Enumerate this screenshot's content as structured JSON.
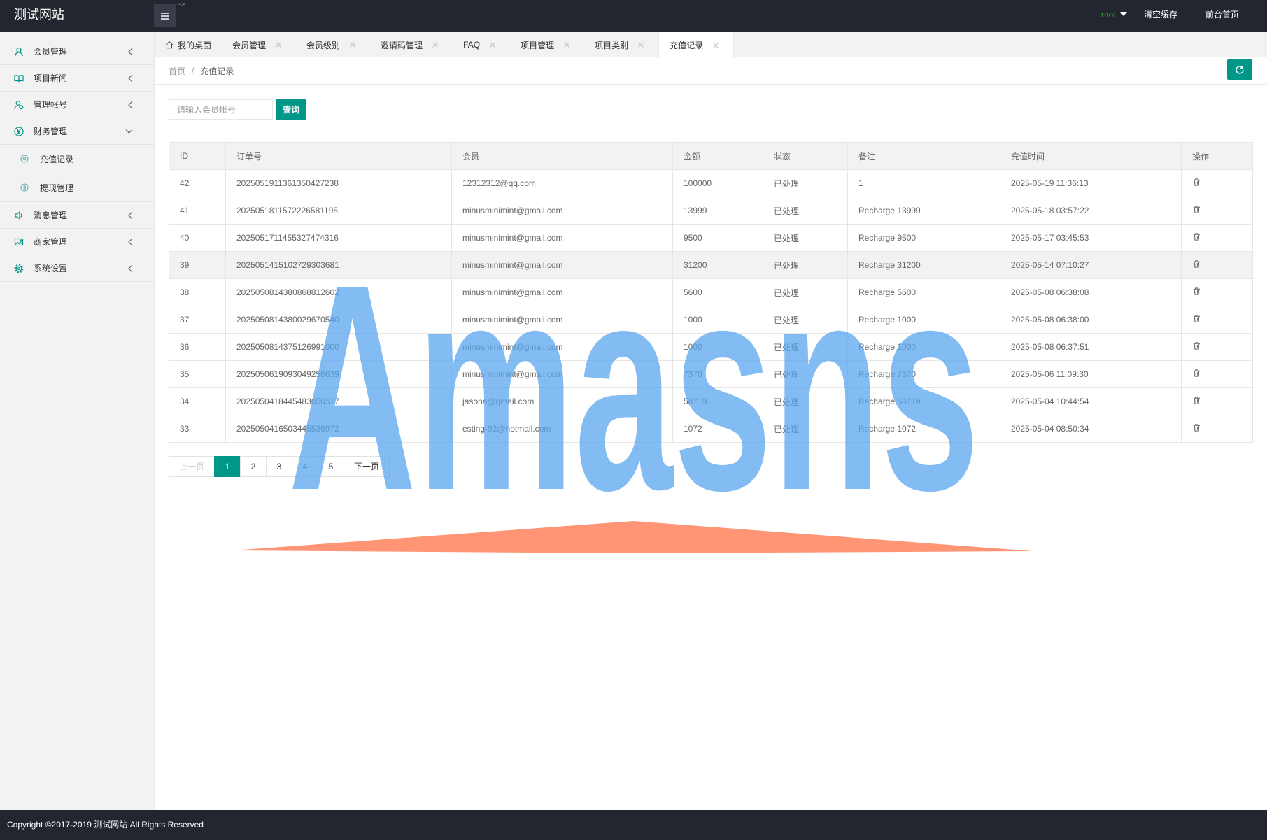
{
  "header": {
    "logo": "测试网站",
    "stray_text": "-->",
    "user": "root",
    "clear_cache": "清空缓存",
    "front_home": "前台首页"
  },
  "sidebar": {
    "items": [
      {
        "label": "会员管理",
        "icon": "user-icon"
      },
      {
        "label": "项目新闻",
        "icon": "book-icon"
      },
      {
        "label": "管理帐号",
        "icon": "users-icon"
      },
      {
        "label": "财务管理",
        "icon": "yen-icon",
        "expanded": true,
        "children": [
          {
            "label": "充值记录",
            "icon": "record-icon"
          },
          {
            "label": "提现管理",
            "icon": "dollar-icon"
          }
        ]
      },
      {
        "label": "消息管理",
        "icon": "speaker-icon"
      },
      {
        "label": "商家管理",
        "icon": "image-icon"
      },
      {
        "label": "系统设置",
        "icon": "gear-icon"
      }
    ]
  },
  "tabs": [
    {
      "label": "我的桌面",
      "icon": "home-icon",
      "closable": false
    },
    {
      "label": "会员管理",
      "closable": true
    },
    {
      "label": "会员级别",
      "closable": true
    },
    {
      "label": "邀请码管理",
      "closable": true
    },
    {
      "label": "FAQ",
      "closable": true
    },
    {
      "label": "项目管理",
      "closable": true
    },
    {
      "label": "项目类别",
      "closable": true
    },
    {
      "label": "充值记录",
      "closable": true,
      "active": true
    }
  ],
  "breadcrumb": {
    "home": "首页",
    "separator": "/",
    "current": "充值记录"
  },
  "search": {
    "placeholder": "请输入会员帐号",
    "value": "",
    "button": "查询"
  },
  "table": {
    "columns": [
      "ID",
      "订单号",
      "会员",
      "金额",
      "状态",
      "备注",
      "充值时间",
      "操作"
    ],
    "rows": [
      {
        "id": "42",
        "order_no": "2025051911361350427238",
        "member": "12312312@qq.com",
        "amount": "100000",
        "status": "已处理",
        "remark": "1",
        "time": "2025-05-19 11:36:13"
      },
      {
        "id": "41",
        "order_no": "2025051811572226581195",
        "member": "minusminimint@gmail.com",
        "amount": "13999",
        "status": "已处理",
        "remark": "Recharge 13999",
        "time": "2025-05-18 03:57:22"
      },
      {
        "id": "40",
        "order_no": "2025051711455327474316",
        "member": "minusminimint@gmail.com",
        "amount": "9500",
        "status": "已处理",
        "remark": "Recharge 9500",
        "time": "2025-05-17 03:45:53"
      },
      {
        "id": "39",
        "order_no": "2025051415102729303681",
        "member": "minusminimint@gmail.com",
        "amount": "31200",
        "status": "已处理",
        "remark": "Recharge 31200",
        "time": "2025-05-14 07:10:27"
      },
      {
        "id": "38",
        "order_no": "2025050814380868812602",
        "member": "minusminimint@gmail.com",
        "amount": "5600",
        "status": "已处理",
        "remark": "Recharge 5600",
        "time": "2025-05-08 06:38:08"
      },
      {
        "id": "37",
        "order_no": "2025050814380029670540",
        "member": "minusminimint@gmail.com",
        "amount": "1000",
        "status": "已处理",
        "remark": "Recharge 1000",
        "time": "2025-05-08 06:38:00"
      },
      {
        "id": "36",
        "order_no": "2025050814375126991000",
        "member": "minusminimint@gmail.com",
        "amount": "1000",
        "status": "已处理",
        "remark": "Recharge 1000",
        "time": "2025-05-08 06:37:51"
      },
      {
        "id": "35",
        "order_no": "2025050619093049256639",
        "member": "minusminimint@gmail.com",
        "amount": "7370",
        "status": "已处理",
        "remark": "Recharge 7370",
        "time": "2025-05-06 11:09:30"
      },
      {
        "id": "34",
        "order_no": "2025050418445483656517",
        "member": "jasona@gmail.com",
        "amount": "58719",
        "status": "已处理",
        "remark": "Recharge 58719",
        "time": "2025-05-04 10:44:54"
      },
      {
        "id": "33",
        "order_no": "2025050416503445536972",
        "member": "esting-92@hotmail.com",
        "amount": "1072",
        "status": "已处理",
        "remark": "Recharge 1072",
        "time": "2025-05-04 08:50:34"
      }
    ]
  },
  "pagination": {
    "prev": "上一页",
    "pages": [
      "1",
      "2",
      "3",
      "4",
      "5"
    ],
    "current": "1",
    "next": "下一页"
  },
  "footer": {
    "copyright": "Copyright ©2017-2019 测试网站 All Rights Reserved"
  },
  "watermark": {
    "text": "Amasns"
  },
  "colors": {
    "accent": "#009688",
    "header_bg": "#23262e",
    "user_name": "#2f9a36",
    "watermark_text": "#5aa5ef",
    "watermark_triangle": "#ff8a65"
  }
}
